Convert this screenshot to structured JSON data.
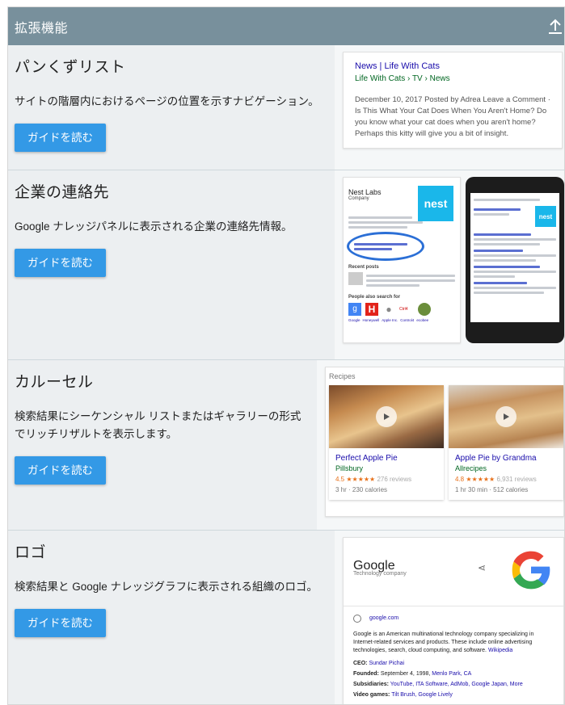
{
  "header": {
    "title": "拡張機能"
  },
  "button_label": "ガイドを読む",
  "sections": [
    {
      "title": "パンくずリスト",
      "description": "サイトの階層内におけるページの位置を示すナビゲーション。"
    },
    {
      "title": "企業の連絡先",
      "description": "Google ナレッジパネルに表示される企業の連絡先情報。"
    },
    {
      "title": "カルーセル",
      "description": "検索結果にシーケンシャル リストまたはギャラリーの形式でリッチリザルトを表示します。"
    },
    {
      "title": "ロゴ",
      "description": "検索結果と Google ナレッジグラフに表示される組織のロゴ。"
    }
  ],
  "breadcrumb_preview": {
    "title": "News | Life With Cats",
    "url": "Life With Cats › TV › News",
    "snippet": "December 10, 2017 Posted by Adrea Leave a Comment · Is This What Your Cat Does When You Aren't Home? Do you know what your cat does when you aren't home? Perhaps this kitty will give you a bit of insight."
  },
  "contact_preview": {
    "name": "Nest Labs",
    "type": "Company",
    "logo_text": "nest",
    "recent_posts": "Recent posts",
    "people_also": "People also search for",
    "related": [
      "Google",
      "Honeywell",
      "Apple Inc.",
      "Control4",
      "ecobee"
    ]
  },
  "carousel_preview": {
    "label": "Recipes",
    "cards": [
      {
        "name": "Perfect Apple Pie",
        "source": "Pillsbury",
        "rating": "4.5 ★★★★★",
        "reviews": "276 reviews",
        "meta": "3 hr · 230 calories"
      },
      {
        "name": "Apple Pie by Grandma",
        "source": "Allrecipes",
        "rating": "4.8 ★★★★★",
        "reviews": "6,931 reviews",
        "meta": "1 hr 30 min · 512 calories"
      }
    ]
  },
  "logo_preview": {
    "name": "Google",
    "subtitle": "Technology company",
    "site": "google.com",
    "description": "Google is an American multinational technology company specializing in Internet-related services and products. These include online advertising technologies, search, cloud computing, and software.",
    "wiki": "Wikipedia",
    "ceo_label": "CEO:",
    "ceo": "Sundar Pichai",
    "founded_label": "Founded:",
    "founded": "September 4, 1998,",
    "founded_place": "Menlo Park, CA",
    "subs_label": "Subsidiaries:",
    "subs": "YouTube, ITA Software, AdMob, Google Japan, More",
    "video_label": "Video games:",
    "video": "Tilt Brush, Google Lively"
  },
  "colors": {
    "header": "#78909c",
    "button": "#3399e6",
    "background": "#eceff1"
  }
}
